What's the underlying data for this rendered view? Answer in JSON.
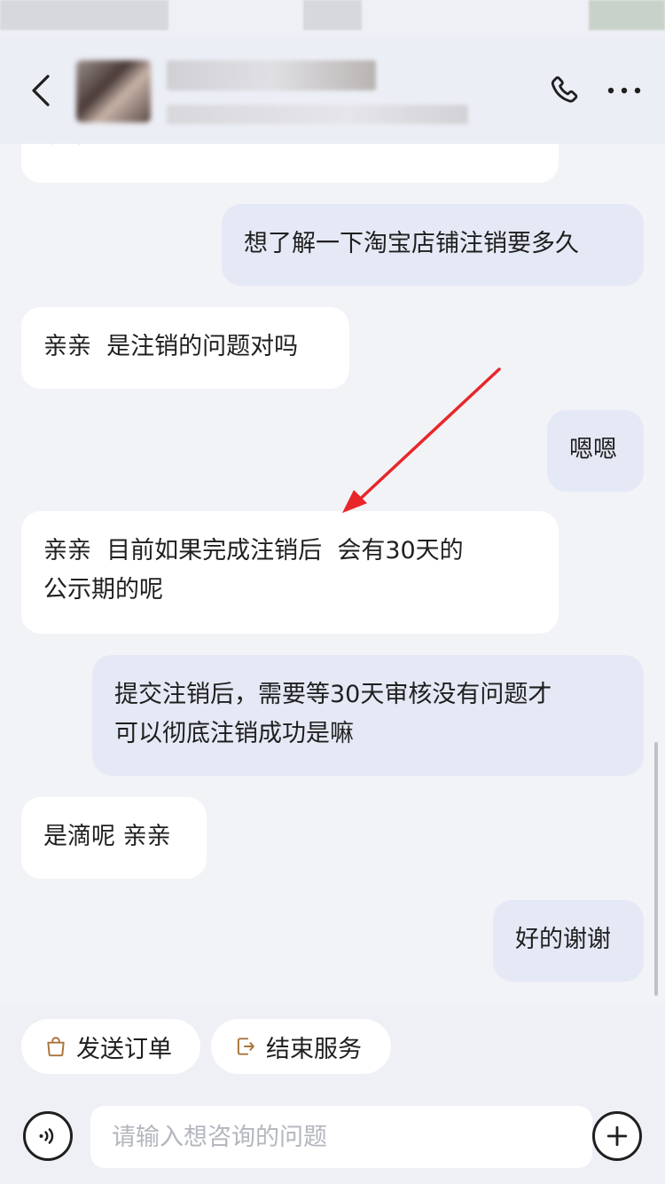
{
  "header": {
    "contact_name": "██████████",
    "contact_subtitle": "████████████████"
  },
  "messages": [
    {
      "side": "agent",
      "text": "议常您？"
    },
    {
      "side": "user",
      "text": "想了解一下淘宝店铺注销要多久"
    },
    {
      "side": "agent",
      "text": "亲亲  是注销的问题对吗"
    },
    {
      "side": "user",
      "text": "嗯嗯"
    },
    {
      "side": "agent",
      "text": "亲亲  目前如果完成注销后  会有30天的\n公示期的呢"
    },
    {
      "side": "user",
      "text": "提交注销后，需要等30天审核没有问题才\n可以彻底注销成功是嘛"
    },
    {
      "side": "agent",
      "text": "是滴呢 亲亲"
    },
    {
      "side": "user",
      "text": "好的谢谢"
    }
  ],
  "quick_actions": {
    "send_order": "发送订单",
    "end_service": "结束服务"
  },
  "input": {
    "placeholder": "请输入想咨询的问题"
  },
  "annotation": {
    "arrow_color": "#e8262a"
  },
  "icons": {
    "back": "chevron-left-icon",
    "phone": "phone-icon",
    "more": "ellipsis-icon",
    "bag": "shopping-bag-icon",
    "exit": "exit-icon",
    "voice": "voice-icon",
    "plus": "plus-icon"
  }
}
